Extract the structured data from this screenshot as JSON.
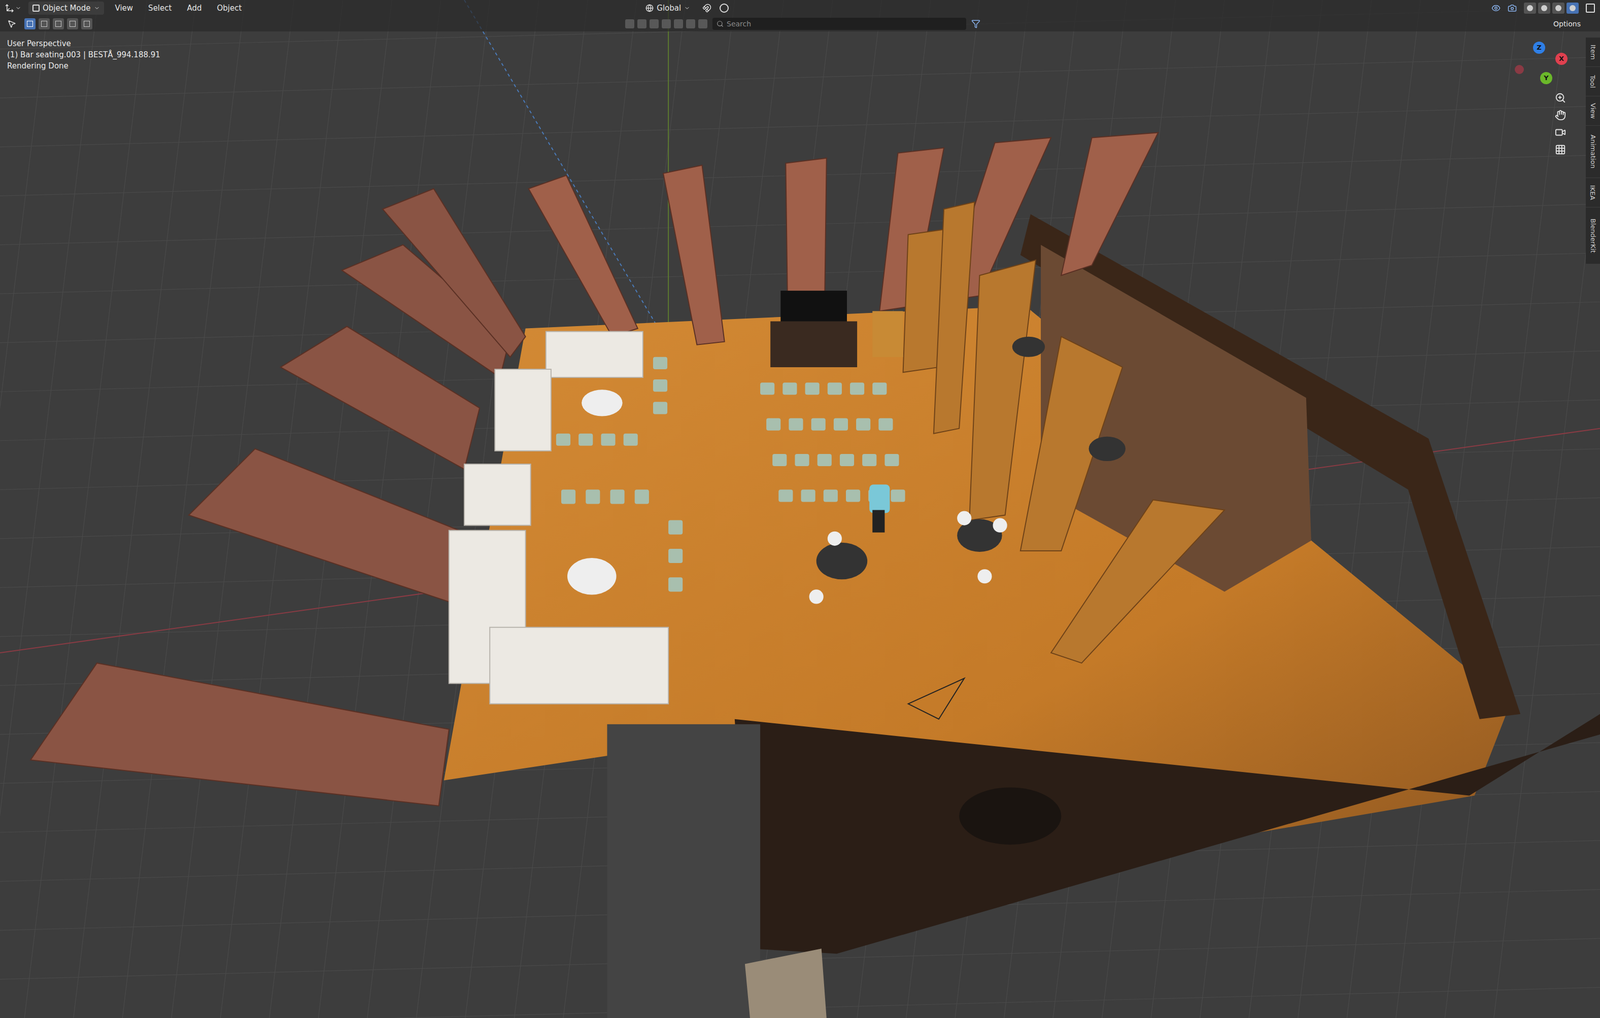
{
  "header": {
    "mode": "Object Mode",
    "menus": [
      "View",
      "Select",
      "Add",
      "Object"
    ],
    "orientation": "Global",
    "options": "Options"
  },
  "search": {
    "placeholder": "Search"
  },
  "overlay": {
    "lines": [
      "User Perspective",
      "(1) Bar seating.003 | BESTÅ_994.188.91",
      "Rendering Done"
    ]
  },
  "selection_modes": [
    {
      "selected": true
    },
    {
      "selected": false
    },
    {
      "selected": false
    },
    {
      "selected": false
    },
    {
      "selected": false
    }
  ],
  "shading_modes": [
    {
      "selected": false
    },
    {
      "selected": false
    },
    {
      "selected": false
    },
    {
      "selected": true
    }
  ],
  "gizmo": {
    "axes": [
      {
        "label": "Z",
        "color": "#2f7fe6"
      },
      {
        "label": "Y",
        "color": "#6bb82a"
      },
      {
        "label": "X",
        "color": "#e0404f"
      }
    ]
  },
  "sidebar_tabs": [
    {
      "label": "Item",
      "selected": false
    },
    {
      "label": "Tool",
      "selected": false
    },
    {
      "label": "View",
      "selected": false
    },
    {
      "label": "Animation",
      "selected": false
    },
    {
      "label": "IKEA",
      "selected": false
    },
    {
      "label": "BlenderKit",
      "selected": false
    }
  ]
}
